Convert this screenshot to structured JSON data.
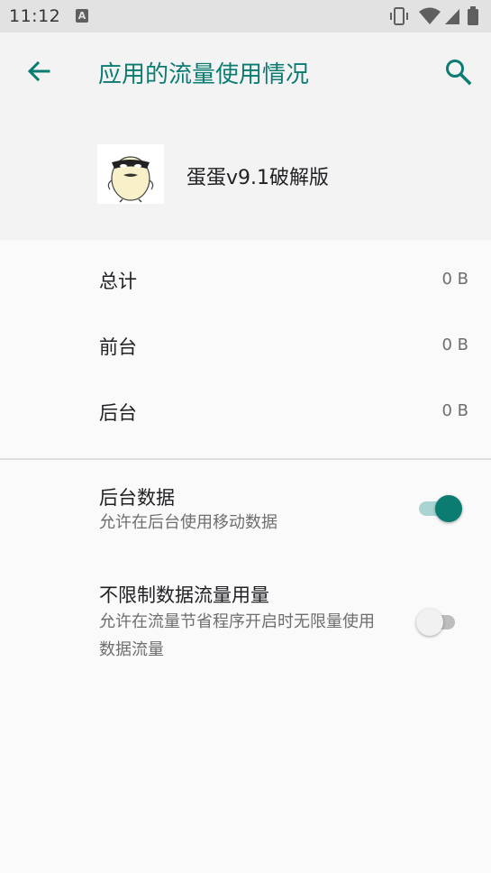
{
  "status_bar": {
    "time": "11:12",
    "notification_letter": "A",
    "icons": [
      "vibrate-icon",
      "wifi-icon",
      "cell-signal-icon",
      "battery-icon"
    ]
  },
  "app_bar": {
    "title": "应用的流量使用情况",
    "back_icon": "arrow-back-icon",
    "search_icon": "search-icon"
  },
  "app_info": {
    "name": "蛋蛋v9.1破解版",
    "icon": "egg-character-icon"
  },
  "usage": [
    {
      "label": "总计",
      "value": "0 B"
    },
    {
      "label": "前台",
      "value": "0 B"
    },
    {
      "label": "后台",
      "value": "0 B"
    }
  ],
  "settings": [
    {
      "title": "后台数据",
      "summary": "允许在后台使用移动数据",
      "enabled": true
    },
    {
      "title": "不限制数据流量用量",
      "summary": "允许在流量节省程序开启时无限量使用数据流量",
      "enabled": false
    }
  ],
  "colors": {
    "accent": "#0b7c72",
    "accent_track": "#a8d5d1",
    "status_bar": "#e2e2e2",
    "header_bg": "#f3f3f3",
    "page_bg": "#fafafa"
  }
}
